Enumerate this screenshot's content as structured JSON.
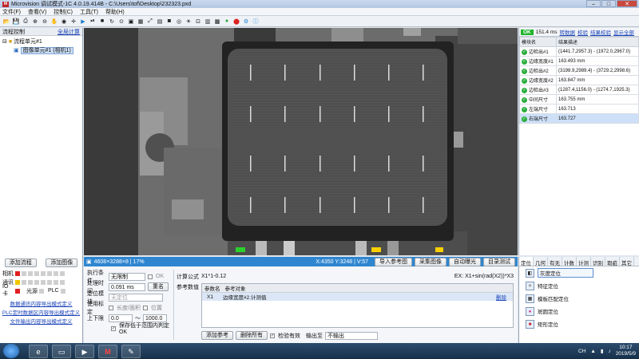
{
  "window": {
    "title": "Microvision 调试模式-1C 4.0.19.414B - C:\\Users\\tof\\Desktop\\232323.pxd",
    "min": "–",
    "max": "□",
    "close": "✕"
  },
  "menu": [
    "文件(F)",
    "查看(V)",
    "控制(C)",
    "工具(T)",
    "帮助(H)"
  ],
  "toolbar_icons": [
    "open-icon",
    "save-icon",
    "print-icon",
    "zoom-in-icon",
    "zoom-out-icon",
    "hand-icon",
    "eye-icon",
    "crosshair-icon",
    "play-icon",
    "step-icon",
    "stop-icon",
    "refresh-icon",
    "record-icon",
    "snapshot-icon",
    "grid-icon",
    "zoom-fit-icon",
    "layout-icon",
    "camera-icon",
    "target-icon",
    "light-icon",
    "measure-icon",
    "table-icon",
    "calculator-icon",
    "green-circle-icon",
    "location-icon",
    "gear-icon",
    "info-icon"
  ],
  "flow": {
    "header": "流程控制",
    "link": "全局计算",
    "tree": [
      "流程单元#1",
      "图像单元#1 (相机1)"
    ]
  },
  "results": {
    "status": "OK",
    "time": "151.4 ms",
    "links": [
      "转数据",
      "校验",
      "结果校验",
      "显示全部"
    ],
    "columns": [
      "模块名",
      "结果描述"
    ],
    "rows": [
      {
        "name": "边检出#1",
        "value": "(1441.7,2957.3) - (1972.0,2967.0)"
      },
      {
        "name": "边缘宽度#1",
        "value": "163.493 mm"
      },
      {
        "name": "边检出#2",
        "value": "(3198.9,2989.4) - (3729.2,2998.6)"
      },
      {
        "name": "边缘宽度#2",
        "value": "163.847 mm"
      },
      {
        "name": "边检出#3",
        "value": "(1287.4,1156.0) - (1274.7,1925.3)"
      },
      {
        "name": "中间尺寸",
        "value": "163.755 mm"
      },
      {
        "name": "左端尺寸",
        "value": "163.713"
      },
      {
        "name": "右端尺寸",
        "value": "163.727"
      }
    ]
  },
  "statusbar": {
    "image_info": "4608×3288×8 | 17%",
    "coords": "X:4350 Y:3248 | V:57",
    "buttons": [
      "导入参考图",
      "采集图像",
      "自动曝光",
      "目录测试"
    ]
  },
  "left_bottom": {
    "add_flow": "添加流程",
    "add_module": "添加图像",
    "io": [
      {
        "label": "相机",
        "lamp": "#e02020"
      },
      {
        "label": "通讯",
        "lamp": "#f2c500"
      },
      {
        "label": "IO卡",
        "lamp": "#e02020",
        "extra1": "光源",
        "extra2": "PLC"
      }
    ],
    "links": [
      "数据通讯内容导出模式定义",
      "PLC定时数据区内容导出模式定义",
      "文件输出内容导出模式定义"
    ]
  },
  "params": {
    "exec_label": "执行条件",
    "exec_value": "无限制",
    "ok_label": "OK",
    "proc_time_label": "处理时间",
    "proc_time_value": "0.091 ms",
    "rename": "重名",
    "ref_label": "定位模块",
    "ref_value": "无定位",
    "use_label": "使用标定",
    "use_opt1": "长度/面积",
    "use_opt2": "位置",
    "range_label": "上下限",
    "range_min": "0.0",
    "range_sep": "～",
    "range_max": "1000.0",
    "save_ng": "保存低于范围内判定OK",
    "formula_label": "计算公式",
    "formula_value": "X1*1-0.12",
    "formula_hint": "EX: X1+sin(rad(X2))*X3",
    "ref_data_label": "参考数值",
    "ref_cols": [
      "参数名",
      "参考对象"
    ],
    "ref_row": {
      "name": "X1",
      "obj": "边缘宽度#2.计测值",
      "del": "删除"
    },
    "add_ref": "添加参考",
    "del_all": "删除所有",
    "check_valid": "检验有效",
    "output_label": "输出至",
    "output_value": "不输出"
  },
  "tools": {
    "tabs": [
      "定位",
      "几何",
      "有无",
      "计数",
      "计测",
      "识别",
      "瑕疵",
      "其它"
    ],
    "items": [
      "灰度定位",
      "特征定位",
      "模板匹配定位",
      "斑圆定位",
      "矩形定位"
    ]
  },
  "taskbar": {
    "tray_lang": "CH",
    "time": "10:17",
    "date": "2019/5/9"
  }
}
